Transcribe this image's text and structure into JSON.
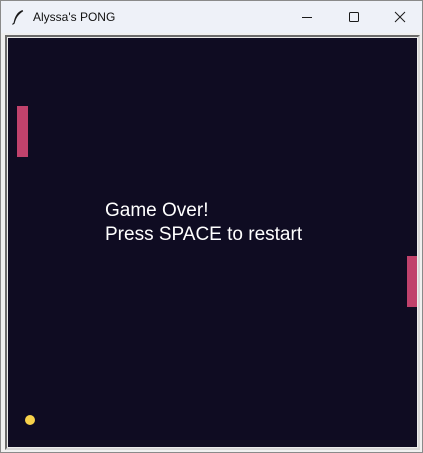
{
  "window": {
    "title": "Alyssa's PONG",
    "app_icon": "feather-icon",
    "controls": {
      "minimize_icon": "minimize-icon",
      "maximize_icon": "maximize-icon",
      "close_icon": "close-icon"
    }
  },
  "game": {
    "background_color": "#0f0c22",
    "paddle_color": "#c0426c",
    "ball_color": "#f7d24a",
    "message": {
      "line1": "Game Over!",
      "line2": "Press SPACE to restart"
    }
  }
}
